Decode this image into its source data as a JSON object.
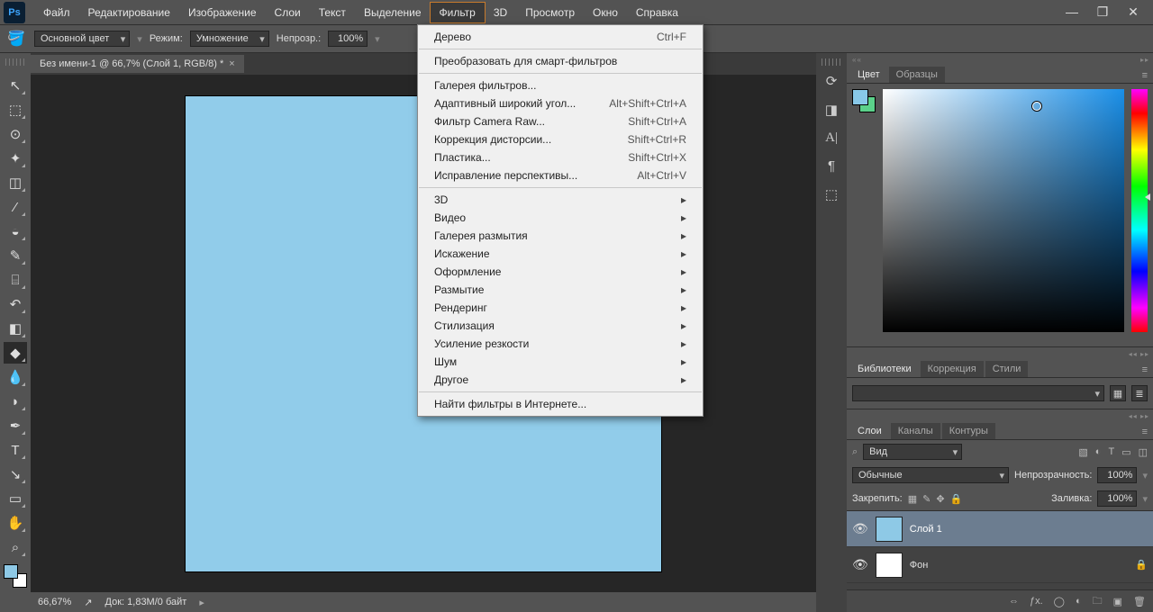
{
  "menubar": {
    "items": [
      "Файл",
      "Редактирование",
      "Изображение",
      "Слои",
      "Текст",
      "Выделение",
      "Фильтр",
      "3D",
      "Просмотр",
      "Окно",
      "Справка"
    ],
    "active": 6,
    "logo": "Ps"
  },
  "options": {
    "swatch_label": "Основной цвет",
    "mode_label": "Режим:",
    "mode_value": "Умножение",
    "opacity_label": "Непрозр.:",
    "opacity_value": "100%"
  },
  "doctab": {
    "title": "Без имени-1 @ 66,7% (Слой 1, RGB/8) *"
  },
  "status": {
    "zoom": "66,67%",
    "docinfo": "Док: 1,83M/0 байт"
  },
  "dropdown": {
    "items": [
      {
        "label": "Дерево",
        "shortcut": "Ctrl+F"
      },
      {
        "sep": true
      },
      {
        "label": "Преобразовать для смарт-фильтров"
      },
      {
        "sep": true
      },
      {
        "label": "Галерея фильтров..."
      },
      {
        "label": "Адаптивный широкий угол...",
        "shortcut": "Alt+Shift+Ctrl+A"
      },
      {
        "label": "Фильтр Camera Raw...",
        "shortcut": "Shift+Ctrl+A"
      },
      {
        "label": "Коррекция дисторсии...",
        "shortcut": "Shift+Ctrl+R"
      },
      {
        "label": "Пластика...",
        "shortcut": "Shift+Ctrl+X"
      },
      {
        "label": "Исправление перспективы...",
        "shortcut": "Alt+Ctrl+V"
      },
      {
        "sep": true
      },
      {
        "label": "3D",
        "sub": true
      },
      {
        "label": "Видео",
        "sub": true
      },
      {
        "label": "Галерея размытия",
        "sub": true
      },
      {
        "label": "Искажение",
        "sub": true
      },
      {
        "label": "Оформление",
        "sub": true
      },
      {
        "label": "Размытие",
        "sub": true
      },
      {
        "label": "Рендеринг",
        "sub": true
      },
      {
        "label": "Стилизация",
        "sub": true
      },
      {
        "label": "Усиление резкости",
        "sub": true
      },
      {
        "label": "Шум",
        "sub": true
      },
      {
        "label": "Другое",
        "sub": true
      },
      {
        "sep": true
      },
      {
        "label": "Найти фильтры в Интернете..."
      }
    ]
  },
  "color_panel": {
    "tabs": [
      "Цвет",
      "Образцы"
    ]
  },
  "libs_panel": {
    "tabs": [
      "Библиотеки",
      "Коррекция",
      "Стили"
    ]
  },
  "layers_panel": {
    "tabs": [
      "Слои",
      "Каналы",
      "Контуры"
    ],
    "kind_label": "Вид",
    "blend_mode": "Обычные",
    "opacity_label": "Непрозрачность:",
    "opacity_value": "100%",
    "lock_label": "Закрепить:",
    "fill_label": "Заливка:",
    "fill_value": "100%",
    "layers": [
      {
        "name": "Слой 1",
        "thumb": "blue",
        "sel": true
      },
      {
        "name": "Фон",
        "thumb": "white",
        "locked": true
      }
    ]
  },
  "tools": [
    "move",
    "marquee",
    "lasso",
    "wand",
    "crop",
    "eyedrop",
    "heal",
    "brush",
    "stamp",
    "history",
    "eraser",
    "bucket",
    "blur",
    "dodge",
    "pen",
    "type",
    "path",
    "shape",
    "hand",
    "zoom"
  ],
  "vbar": [
    "history",
    "props",
    "char",
    "para",
    "3d"
  ]
}
